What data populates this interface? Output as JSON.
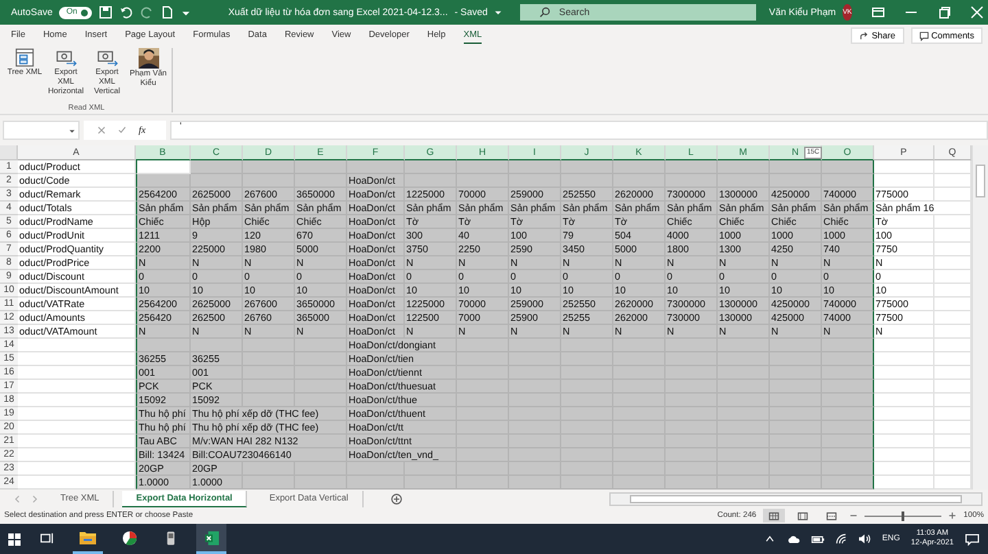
{
  "title_bar": {
    "autosave": {
      "label": "AutoSave",
      "state": "On",
      "on": true
    },
    "title": "Xuất dữ liệu từ hóa đơn sang Excel 2021-04-12.3...",
    "status": "- Saved",
    "search": {
      "placeholder": "Search"
    },
    "user": "Văn Kiểu Phạm",
    "avatar": "VK"
  },
  "ribbon_tabs": [
    {
      "label": "File",
      "selected": false
    },
    {
      "label": "Home",
      "selected": false
    },
    {
      "label": "Insert",
      "selected": false
    },
    {
      "label": "Page Layout",
      "selected": false
    },
    {
      "label": "Formulas",
      "selected": false
    },
    {
      "label": "Data",
      "selected": false
    },
    {
      "label": "Review",
      "selected": false
    },
    {
      "label": "View",
      "selected": false
    },
    {
      "label": "Developer",
      "selected": false
    },
    {
      "label": "Help",
      "selected": false
    },
    {
      "label": "XML",
      "selected": true
    }
  ],
  "ribbon_actions": [
    {
      "kind": "share",
      "label": "Share"
    },
    {
      "kind": "comments",
      "label": "Comments"
    }
  ],
  "ribbon_group": {
    "label": "Read XML",
    "buttons": [
      {
        "kind": "tree",
        "label": "Tree XML"
      },
      {
        "kind": "export",
        "label": "Export XML Horizontal"
      },
      {
        "kind": "export",
        "label": "Export XML Vertical"
      },
      {
        "label": "Phạm Văn Kiểu"
      }
    ]
  },
  "formula_bar": {
    "function_label": "fx",
    "content": "'"
  },
  "sheet": {
    "selection_tip": "15C",
    "columns": [
      {
        "label": "A",
        "selected": false
      },
      {
        "label": "B",
        "selected": true
      },
      {
        "label": "C",
        "selected": true
      },
      {
        "label": "D",
        "selected": true
      },
      {
        "label": "E",
        "selected": true
      },
      {
        "label": "F",
        "selected": true
      },
      {
        "label": "G",
        "selected": true
      },
      {
        "label": "H",
        "selected": true
      },
      {
        "label": "I",
        "selected": true
      },
      {
        "label": "J",
        "selected": true
      },
      {
        "label": "K",
        "selected": true
      },
      {
        "label": "L",
        "selected": true
      },
      {
        "label": "M",
        "selected": true
      },
      {
        "label": "N",
        "selected": true
      },
      {
        "label": "O",
        "selected": true
      },
      {
        "label": "P",
        "selected": false
      },
      {
        "label": "Q",
        "selected": false
      }
    ],
    "rows": [
      {
        "number": "1",
        "cells": [
          "oduct/Product"
        ]
      },
      {
        "number": "2",
        "cells": [
          "oduct/Code",
          null,
          null,
          null,
          null,
          "HoaDon/ct"
        ]
      },
      {
        "number": "3",
        "cells": [
          "oduct/Remark",
          "2564200",
          "2625000",
          "267600",
          "3650000",
          "HoaDon/ct",
          "1225000",
          "70000",
          "259000",
          "252550",
          "2620000",
          "7300000",
          "1300000",
          "4250000",
          "740000",
          "775000"
        ]
      },
      {
        "number": "4",
        "cells": [
          "oduct/Totals",
          "Sản phẩm",
          "Sản phẩm",
          "Sản phẩm",
          "Sản phẩm",
          "HoaDon/ct",
          "Sản phẩm",
          "Sản phẩm",
          "Sản phẩm",
          "Sản phẩm",
          "Sản phẩm",
          "Sản phẩm",
          "Sản phẩm",
          "Sản phẩm",
          "Sản phẩm",
          "Sản phẩm 16"
        ]
      },
      {
        "number": "5",
        "cells": [
          "oduct/ProdName",
          "Chiếc",
          "Hộp",
          "Chiếc",
          "Chiếc",
          "HoaDon/ct",
          "Tờ",
          "Tờ",
          "Tờ",
          "Tờ",
          "Tờ",
          "Chiếc",
          "Chiếc",
          "Chiếc",
          "Chiếc",
          "Tờ"
        ]
      },
      {
        "number": "6",
        "cells": [
          "oduct/ProdUnit",
          "1211",
          "9",
          "120",
          "670",
          "HoaDon/ct",
          "300",
          "40",
          "100",
          "79",
          "504",
          "4000",
          "1000",
          "1000",
          "1000",
          "100"
        ]
      },
      {
        "number": "7",
        "cells": [
          "oduct/ProdQuantity",
          "2200",
          "225000",
          "1980",
          "5000",
          "HoaDon/ct",
          "3750",
          "2250",
          "2590",
          "3450",
          "5000",
          "1800",
          "1300",
          "4250",
          "740",
          "7750"
        ]
      },
      {
        "number": "8",
        "cells": [
          "oduct/ProdPrice",
          "N",
          "N",
          "N",
          "N",
          "HoaDon/ct",
          "N",
          "N",
          "N",
          "N",
          "N",
          "N",
          "N",
          "N",
          "N",
          "N"
        ]
      },
      {
        "number": "9",
        "cells": [
          "oduct/Discount",
          "0",
          "0",
          "0",
          "0",
          "HoaDon/ct",
          "0",
          "0",
          "0",
          "0",
          "0",
          "0",
          "0",
          "0",
          "0",
          "0"
        ]
      },
      {
        "number": "10",
        "cells": [
          "oduct/DiscountAmount",
          "10",
          "10",
          "10",
          "10",
          "HoaDon/ct",
          "10",
          "10",
          "10",
          "10",
          "10",
          "10",
          "10",
          "10",
          "10",
          "10"
        ]
      },
      {
        "number": "11",
        "cells": [
          "oduct/VATRate",
          "2564200",
          "2625000",
          "267600",
          "3650000",
          "HoaDon/ct",
          "1225000",
          "70000",
          "259000",
          "252550",
          "2620000",
          "7300000",
          "1300000",
          "4250000",
          "740000",
          "775000"
        ]
      },
      {
        "number": "12",
        "cells": [
          "oduct/Amounts",
          "256420",
          "262500",
          "26760",
          "365000",
          "HoaDon/ct",
          "122500",
          "7000",
          "25900",
          "25255",
          "262000",
          "730000",
          "130000",
          "425000",
          "74000",
          "77500"
        ]
      },
      {
        "number": "13",
        "cells": [
          "oduct/VATAmount",
          "N",
          "N",
          "N",
          "N",
          "HoaDon/ct",
          "N",
          "N",
          "N",
          "N",
          "N",
          "N",
          "N",
          "N",
          "N",
          "N"
        ]
      },
      {
        "number": "14",
        "cells": [
          null,
          null,
          null,
          null,
          null,
          "HoaDon/ct/dongiant"
        ]
      },
      {
        "number": "15",
        "cells": [
          null,
          "36255",
          "36255",
          null,
          null,
          "HoaDon/ct/tien"
        ]
      },
      {
        "number": "16",
        "cells": [
          null,
          "001",
          "001",
          null,
          null,
          "HoaDon/ct/tiennt"
        ]
      },
      {
        "number": "17",
        "cells": [
          null,
          "PCK",
          "PCK",
          null,
          null,
          "HoaDon/ct/thuesuat"
        ]
      },
      {
        "number": "18",
        "cells": [
          null,
          "15092",
          "15092",
          null,
          null,
          "HoaDon/ct/thue"
        ]
      },
      {
        "number": "19",
        "cells": [
          null,
          "Thu hộ phí",
          "Thu hộ phí xếp dỡ (THC fee)",
          null,
          null,
          "HoaDon/ct/thuent"
        ]
      },
      {
        "number": "20",
        "cells": [
          null,
          "Thu hộ phí",
          "Thu hộ phí xếp dỡ (THC fee)",
          null,
          null,
          "HoaDon/ct/tt"
        ]
      },
      {
        "number": "21",
        "cells": [
          null,
          "Tau ABC",
          "M/v:WAN HAI 282 N132",
          null,
          null,
          "HoaDon/ct/ttnt"
        ]
      },
      {
        "number": "22",
        "cells": [
          null,
          "Bill: 13424",
          "Bill:COAU7230466140",
          null,
          null,
          "HoaDon/ct/ten_vnd_"
        ]
      },
      {
        "number": "23",
        "cells": [
          null,
          "20GP",
          "20GP"
        ]
      },
      {
        "number": "24",
        "cells": [
          null,
          "1.0000",
          "1.0000"
        ]
      }
    ]
  },
  "sheet_tabs": [
    {
      "label": "Tree XML",
      "selected": false
    },
    {
      "label": "Export Data Horizontal",
      "selected": true
    },
    {
      "label": "Export Data Vertical",
      "selected": false
    }
  ],
  "status_bar": {
    "message": "Select destination and press ENTER or choose Paste",
    "count": "Count: 246",
    "views": [
      {
        "kind": "normal",
        "selected": true
      },
      {
        "kind": "layout",
        "selected": false
      },
      {
        "kind": "break",
        "selected": false
      }
    ],
    "zoom": {
      "level": 0.5,
      "reading": "100%"
    }
  },
  "taskbar": {
    "apps": [
      {
        "kind": "taskview",
        "open": false,
        "active": false
      },
      {
        "kind": "explorer",
        "open": true,
        "active": false
      },
      {
        "kind": "chart",
        "open": false,
        "active": false
      },
      {
        "kind": "device",
        "open": false,
        "active": false
      },
      {
        "kind": "excel",
        "open": true,
        "active": true
      }
    ],
    "language": "ENG",
    "time": "11:03 AM",
    "date": "12-Apr-2021"
  }
}
